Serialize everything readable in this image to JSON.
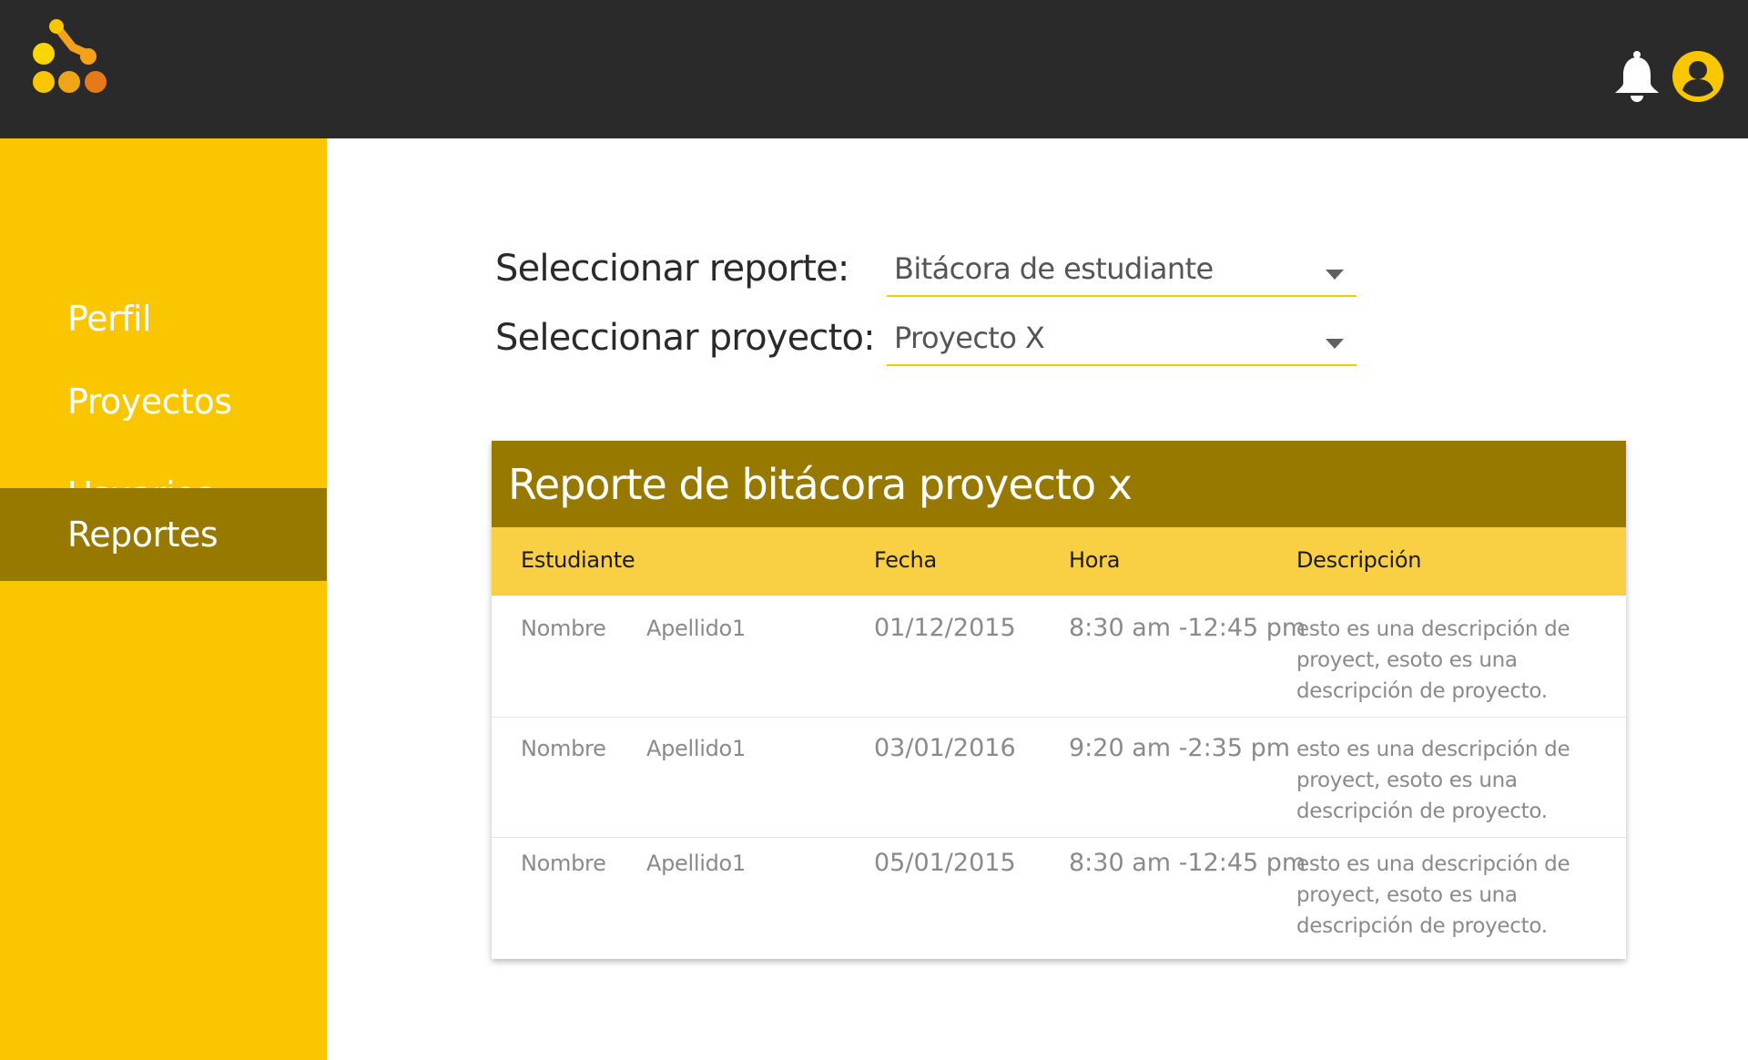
{
  "header": {
    "logo_icon": "molecule-logo-icon",
    "notification_icon": "bell-icon",
    "profile_icon": "user-circle-icon",
    "colors": {
      "bar": "#2a2a2a",
      "accent": "#f9c600"
    }
  },
  "sidebar": {
    "items": [
      {
        "label": "Perfil",
        "active": false
      },
      {
        "label": "Proyectos",
        "active": false
      },
      {
        "label": "Usuarios",
        "active": false
      },
      {
        "label": "Reportes",
        "active": true
      }
    ],
    "colors": {
      "background": "#f9c600",
      "active": "#977900"
    }
  },
  "filters": {
    "report_label": "Seleccionar reporte:",
    "report_value": "Bitácora de estudiante",
    "project_label": "Seleccionar proyecto:",
    "project_value": "Proyecto X"
  },
  "report": {
    "title": "Reporte de bitácora proyecto x",
    "columns": [
      "Estudiante",
      "Fecha",
      "Hora",
      "Descripción"
    ],
    "rows": [
      {
        "nombre": "Nombre",
        "apellido": "Apellido1",
        "fecha": "01/12/2015",
        "hora": "8:30 am -12:45 pm",
        "descripcion": "esto es una descripción de proyect, esoto es una descripción de proyecto."
      },
      {
        "nombre": "Nombre",
        "apellido": "Apellido1",
        "fecha": "03/01/2016",
        "hora": "9:20 am -2:35 pm",
        "descripcion": "esto es una descripción de proyect, esoto es una descripción de proyecto."
      },
      {
        "nombre": "Nombre",
        "apellido": "Apellido1",
        "fecha": "05/01/2015",
        "hora": "8:30 am -12:45 pm",
        "descripcion": "esto es una descripción de proyect, esoto es una descripción de proyecto."
      }
    ],
    "colors": {
      "title_bar": "#977900",
      "header_row": "#f9cf43"
    }
  }
}
